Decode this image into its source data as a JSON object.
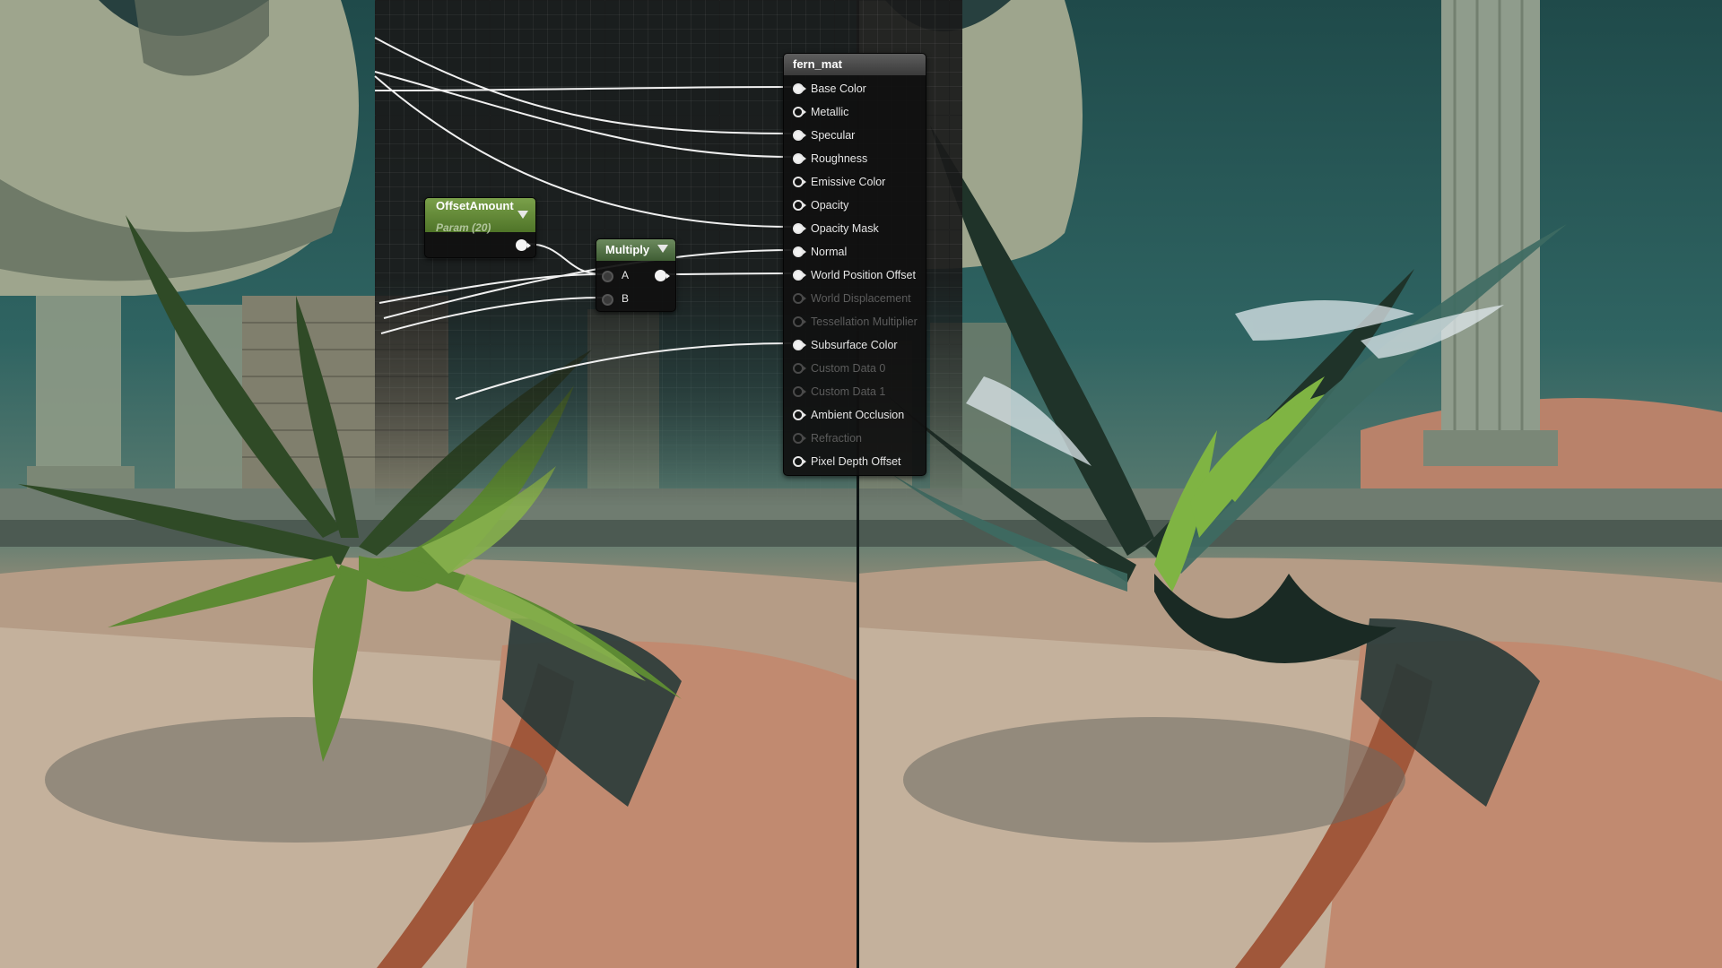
{
  "colors": {
    "graph_bg": "#1a1a1a",
    "param_header": "#5f8a35",
    "result_header": "#4a4a4a",
    "multiply_header": "#54744a",
    "wire": "#f0f0f0",
    "disabled_text": "#5c5c5c"
  },
  "nodes": {
    "param": {
      "title": "OffsetAmount",
      "subtitle": "Param (20)",
      "dropdown_icon": "chevron-down-icon"
    },
    "multiply": {
      "title": "Multiply",
      "dropdown_icon": "chevron-down-icon",
      "inputs": [
        "A",
        "B"
      ]
    },
    "material": {
      "title": "fern_mat",
      "inputs": [
        {
          "label": "Base Color",
          "enabled": true,
          "connected": true
        },
        {
          "label": "Metallic",
          "enabled": true,
          "connected": false
        },
        {
          "label": "Specular",
          "enabled": true,
          "connected": true
        },
        {
          "label": "Roughness",
          "enabled": true,
          "connected": true
        },
        {
          "label": "Emissive Color",
          "enabled": true,
          "connected": false
        },
        {
          "label": "Opacity",
          "enabled": true,
          "connected": false
        },
        {
          "label": "Opacity Mask",
          "enabled": true,
          "connected": true
        },
        {
          "label": "Normal",
          "enabled": true,
          "connected": true
        },
        {
          "label": "World Position Offset",
          "enabled": true,
          "connected": true
        },
        {
          "label": "World Displacement",
          "enabled": false,
          "connected": false
        },
        {
          "label": "Tessellation Multiplier",
          "enabled": false,
          "connected": false
        },
        {
          "label": "Subsurface Color",
          "enabled": true,
          "connected": true
        },
        {
          "label": "Custom Data 0",
          "enabled": false,
          "connected": false
        },
        {
          "label": "Custom Data 1",
          "enabled": false,
          "connected": false
        },
        {
          "label": "Ambient Occlusion",
          "enabled": true,
          "connected": false
        },
        {
          "label": "Refraction",
          "enabled": false,
          "connected": false
        },
        {
          "label": "Pixel Depth Offset",
          "enabled": true,
          "connected": false
        }
      ]
    }
  },
  "viewports": {
    "left": {
      "content": "fern-scene-render-without-offset"
    },
    "right": {
      "content": "fern-scene-render-with-offset"
    }
  }
}
